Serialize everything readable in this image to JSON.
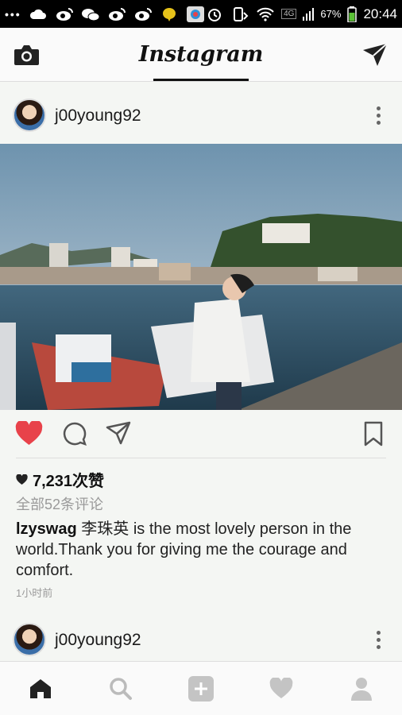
{
  "status_bar": {
    "dots": "•••",
    "signal_label": "4G",
    "battery_percent": "67%",
    "time": "20:44"
  },
  "header": {
    "title": "Instagram"
  },
  "posts": [
    {
      "username": "j00young92",
      "likes_text": "7,231次赞",
      "comments_link": "全部52条评论",
      "caption_user": "lzyswag",
      "caption_text": " 李珠英 is the most lovely person in the world.Thank you for giving me the courage and comfort.",
      "time_ago": "1小时前",
      "liked": true
    },
    {
      "username": "j00young92"
    }
  ],
  "colors": {
    "like_red": "#e8424a",
    "status_bg": "#000000",
    "header_bg": "#fafafa",
    "page_bg": "#f4f6f3"
  },
  "icons": {
    "camera": "camera-icon",
    "send": "send-icon",
    "heart": "heart-icon",
    "comment": "comment-icon",
    "share": "share-icon",
    "bookmark": "bookmark-icon",
    "home": "home-icon",
    "search": "search-icon",
    "add": "add-icon",
    "activity": "activity-heart-icon",
    "profile": "profile-icon"
  }
}
